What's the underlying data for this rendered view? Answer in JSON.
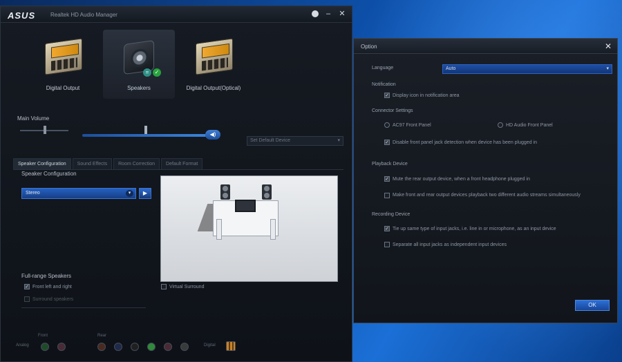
{
  "main_window": {
    "logo": "ASUS",
    "title": "Realtek HD Audio Manager",
    "devices": [
      {
        "label": "Digital Output"
      },
      {
        "label": "Speakers"
      },
      {
        "label": "Digital Output(Optical)"
      }
    ],
    "master_volume_label": "Main Volume",
    "set_default_label": "Set Default Device",
    "tabs": [
      {
        "label": "Speaker Configuration"
      },
      {
        "label": "Sound Effects"
      },
      {
        "label": "Room Correction"
      },
      {
        "label": "Default Format"
      }
    ],
    "speaker_config_label": "Speaker Configuration",
    "speaker_config_value": "Stereo",
    "full_range_label": "Full-range Speakers",
    "front_lr_label": "Front left and right",
    "surround_label": "Surround speakers",
    "virtual_surround_label": "Virtual Surround",
    "analog_label": "Analog",
    "front_label": "Front",
    "rear_label": "Rear",
    "digital_label": "Digital"
  },
  "option_dialog": {
    "title": "Option",
    "language_label": "Language",
    "language_value": "Auto",
    "notification_heading": "Notification",
    "notification_check": "Display icon in notification area",
    "connector_heading": "Connector Settings",
    "radio_ac97": "AC97 Front Panel",
    "radio_hd": "HD Audio Front Panel",
    "disable_front_jack": "Disable front panel jack detection when device has been plugged in",
    "playback_heading": "Playback Device",
    "playback_opt1": "Mute the rear output device, when a front headphone plugged in",
    "playback_opt2": "Make front and rear output devices playback two different audio streams simultaneously",
    "recording_heading": "Recording Device",
    "recording_opt1": "Tie up same type of input jacks, i.e. line in or microphone, as an input device",
    "recording_opt2": "Separate all input jacks as independent input devices",
    "ok_label": "OK"
  },
  "colors": {
    "accent": "#2560c0",
    "panel": "#161b23",
    "desktop": "#0d4fa8"
  }
}
